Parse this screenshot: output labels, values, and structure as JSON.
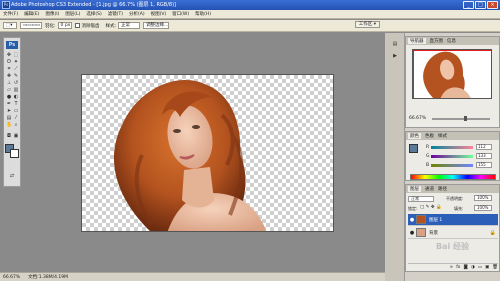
{
  "title_bar": {
    "app_title": "Adobe Photoshop CS3 Extended - [1.jpg @ 66.7% (图层 1, RGB/8)]",
    "logo_text": "Ps",
    "minimize": "_",
    "maximize": "□",
    "close": "×"
  },
  "menu": {
    "items": [
      "文件(F)",
      "编辑(E)",
      "图像(I)",
      "图层(L)",
      "选择(S)",
      "滤镜(T)",
      "分析(A)",
      "视图(V)",
      "窗口(W)",
      "帮助(H)"
    ],
    "workspace": "工作区 ▾"
  },
  "options": {
    "feather_label": "羽化:",
    "feather_value": "0 px",
    "antialias_label": "消除锯齿",
    "style_label": "样式:",
    "style_value": "正常",
    "refine_edge": "调整边缘..."
  },
  "toolbox": {
    "logo": "Ps"
  },
  "status": {
    "zoom": "66.67%",
    "doc": "文档:1.38M/4.19M"
  },
  "navigator": {
    "tabs": [
      "导航器",
      "直方图",
      "信息"
    ],
    "zoom": "66.67%"
  },
  "color_panel": {
    "tabs": [
      "颜色",
      "色板",
      "样式"
    ],
    "rows": [
      {
        "letter": "R",
        "value": "112"
      },
      {
        "letter": "G",
        "value": "133"
      },
      {
        "letter": "B",
        "value": "155"
      }
    ]
  },
  "layers_panel": {
    "tabs": [
      "图层",
      "通道",
      "路径"
    ],
    "blend_mode": "正常",
    "opacity_label": "不透明度:",
    "opacity_value": "100%",
    "lock_label": "锁定:",
    "fill_label": "填充:",
    "fill_value": "100%",
    "layers": [
      {
        "name": "图层 1",
        "selected": true
      },
      {
        "name": "背景",
        "selected": false
      }
    ],
    "watermark": "Bai 经验"
  },
  "colors": {
    "foreground": "#5a7a9a",
    "background": "#ffffff",
    "hair": "#b4531f",
    "skin": "#e8b89a"
  }
}
